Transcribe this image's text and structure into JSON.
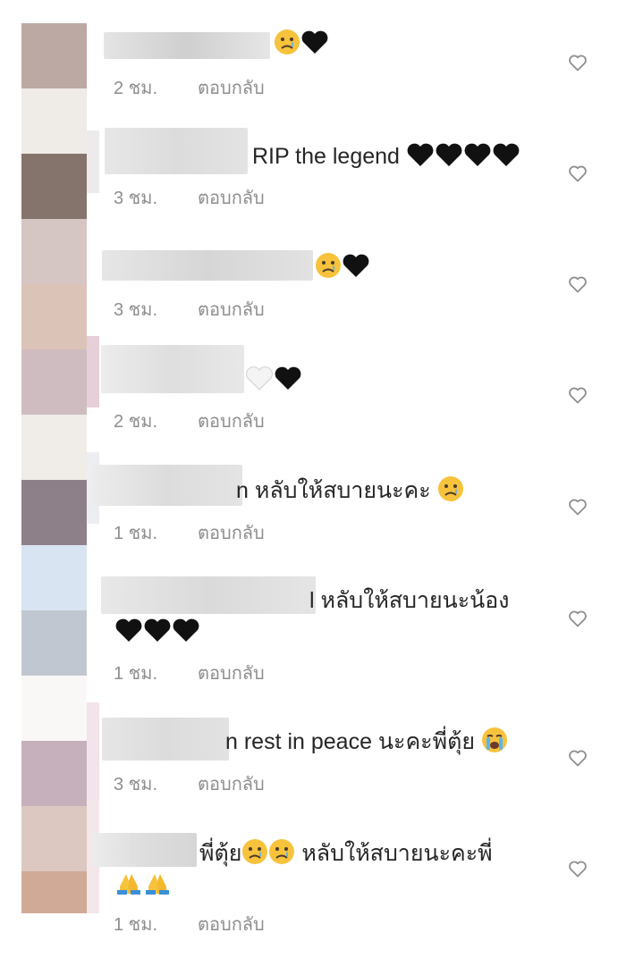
{
  "palette": {
    "text": "#262626",
    "meta": "#8e8e8e",
    "blur_light": "#e6e6e6",
    "blur_mid": "#dadada"
  },
  "comments": [
    {
      "body": "",
      "emojis": [
        "sad-emoji",
        "black-heart-emoji"
      ],
      "time": "2 ชม.",
      "reply": "ตอบกลับ"
    },
    {
      "body": "RIP the legend",
      "emojis": [
        "black-heart-emoji",
        "black-heart-emoji",
        "black-heart-emoji",
        "black-heart-emoji"
      ],
      "time": "3 ชม.",
      "reply": "ตอบกลับ"
    },
    {
      "body": "",
      "emojis": [
        "sad-emoji",
        "black-heart-emoji"
      ],
      "time": "3 ชม.",
      "reply": "ตอบกลับ"
    },
    {
      "body": "",
      "emojis": [
        "white-heart-emoji",
        "black-heart-emoji"
      ],
      "time": "2 ชม.",
      "reply": "ตอบกลับ"
    },
    {
      "body": "n หลับให้สบายนะคะ",
      "emojis": [
        "sad-emoji"
      ],
      "time": "1 ชม.",
      "reply": "ตอบกลับ"
    },
    {
      "body": "l หลับให้สบายนะน้อง",
      "emojis": [
        "black-heart-emoji",
        "black-heart-emoji",
        "black-heart-emoji"
      ],
      "time": "1 ชม.",
      "reply": "ตอบกลับ"
    },
    {
      "body": "n rest in peace นะคะพี่ตุ้ย",
      "emojis": [
        "crying-emoji"
      ],
      "time": "3 ชม.",
      "reply": "ตอบกลับ"
    },
    {
      "body_a": "พี่ตุ้ย",
      "body_b": "หลับให้สบายนะคะพี่",
      "emojis": [
        "sad-emoji",
        "sad-emoji",
        "folded-hands-emoji",
        "folded-hands-emoji"
      ],
      "time": "1 ชม.",
      "reply": "ตอบกลับ"
    }
  ]
}
